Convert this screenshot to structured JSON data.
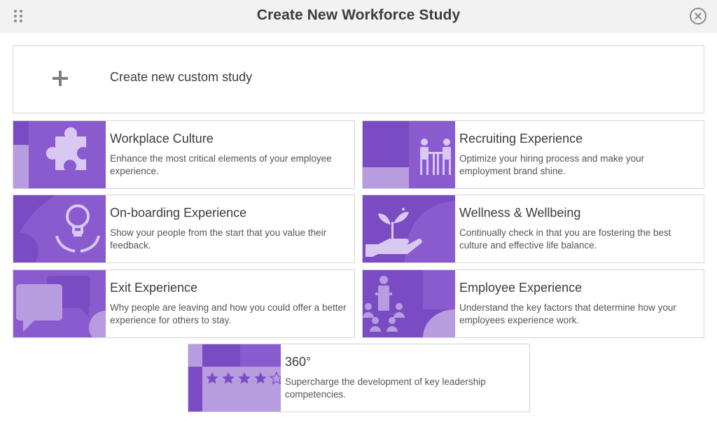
{
  "header": {
    "title": "Create New Workforce Study",
    "drag_icon": "drag-handle-icon",
    "close_icon": "close-circle-icon"
  },
  "custom_study": {
    "icon": "plus-icon",
    "label": "Create new custom study"
  },
  "studies": [
    {
      "id": "workplace-culture",
      "title": "Workplace Culture",
      "description": "Enhance the most critical elements of your employee experience.",
      "icon": "puzzle-piece-icon"
    },
    {
      "id": "recruiting-experience",
      "title": "Recruiting Experience",
      "description": "Optimize your hiring process and make your employment brand shine.",
      "icon": "interview-table-icon"
    },
    {
      "id": "onboarding-experience",
      "title": "On-boarding Experience",
      "description": "Show your people from the start that you value their feedback.",
      "icon": "lightbulb-hands-icon"
    },
    {
      "id": "wellness-wellbeing",
      "title": "Wellness & Wellbeing",
      "description": "Continually check in that you are fostering the best culture and effective life balance.",
      "icon": "plant-hand-icon"
    },
    {
      "id": "exit-experience",
      "title": "Exit Experience",
      "description": "Why people are leaving and how you could offer a better experience for others to stay.",
      "icon": "speech-bubbles-icon"
    },
    {
      "id": "employee-experience",
      "title": "Employee Experience",
      "description": "Understand the key factors that determine how your employees experience work.",
      "icon": "presenter-audience-icon"
    },
    {
      "id": "360",
      "title": "360°",
      "description": "Supercharge the development of key leadership competencies.",
      "icon": "star-rating-icon"
    }
  ],
  "colors": {
    "purple_dark": "#7b4bc4",
    "purple_mid": "#8a5bcf",
    "purple_light": "#b79ce0",
    "icon_fill": "#d9c8f2"
  }
}
